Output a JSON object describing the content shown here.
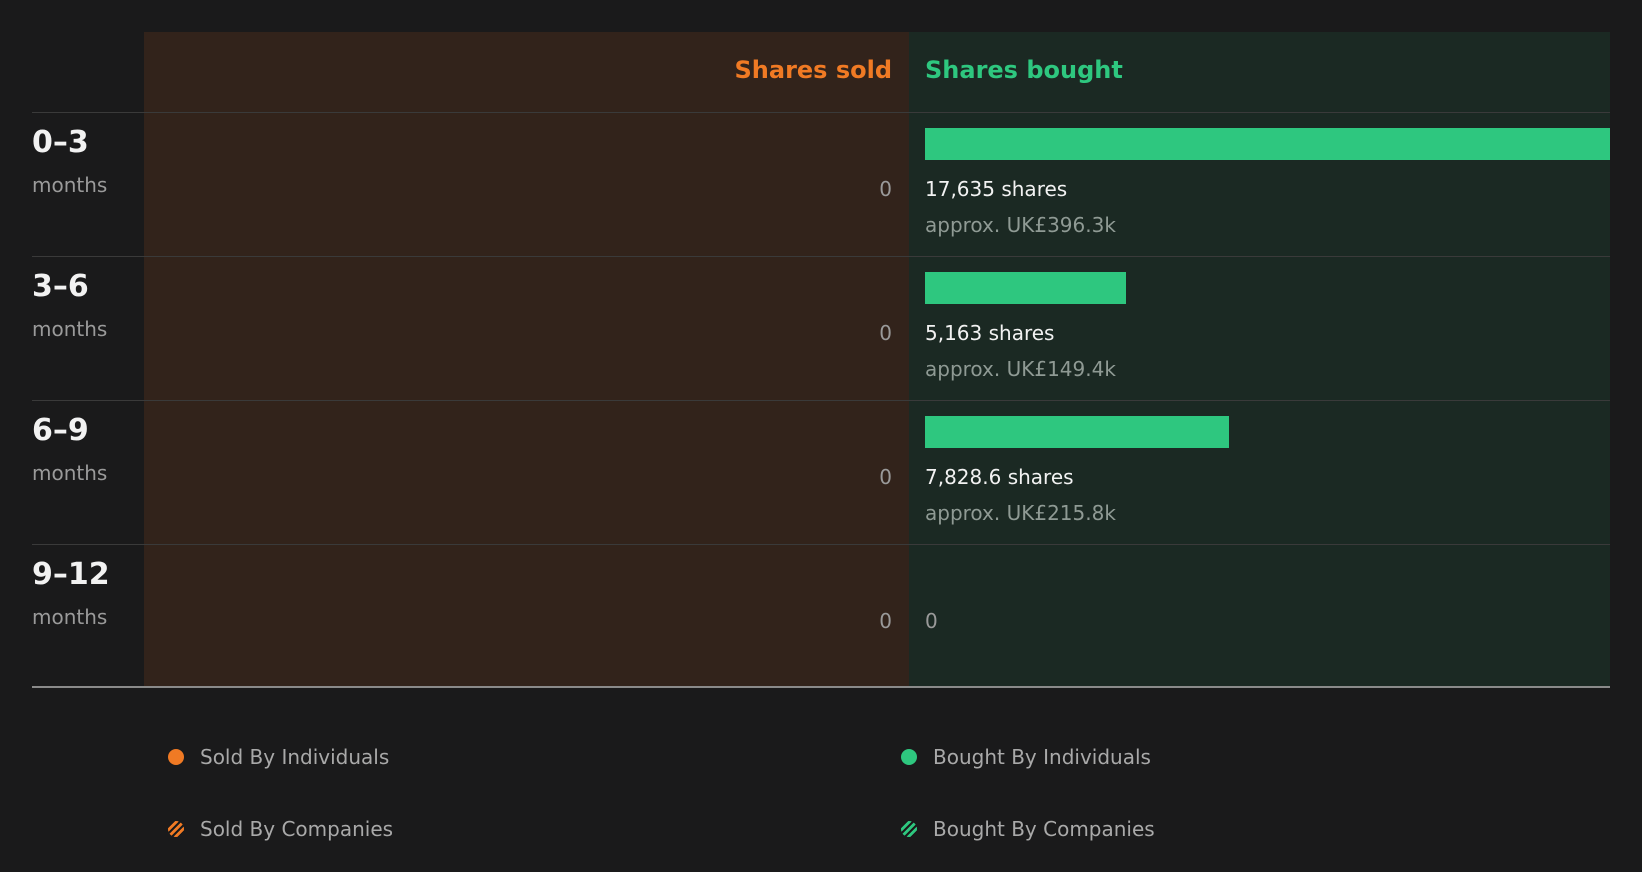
{
  "colors": {
    "sold": "#f07a24",
    "bought": "#2ec77f",
    "sold_bg": "#32231b",
    "bought_bg": "#1b2923",
    "background": "#1a1a1b"
  },
  "headers": {
    "sold": "Shares sold",
    "bought": "Shares bought"
  },
  "chart_data": {
    "type": "bar",
    "orientation": "horizontal-diverging",
    "categories": [
      "0–3 months",
      "3–6 months",
      "6–9 months",
      "9–12 months"
    ],
    "series": [
      {
        "name": "Shares sold",
        "values": [
          0,
          0,
          0,
          0
        ]
      },
      {
        "name": "Shares bought",
        "values": [
          17635,
          5163,
          7828.6,
          0
        ]
      }
    ],
    "xmax": 17635
  },
  "rows": [
    {
      "period": "0–3",
      "unit": "months",
      "sold": "0",
      "bought_value": 17635,
      "bought_shares": "17,635 shares",
      "bought_approx": "approx. UK£396.3k",
      "bought_zero": ""
    },
    {
      "period": "3–6",
      "unit": "months",
      "sold": "0",
      "bought_value": 5163,
      "bought_shares": "5,163 shares",
      "bought_approx": "approx. UK£149.4k",
      "bought_zero": ""
    },
    {
      "period": "6–9",
      "unit": "months",
      "sold": "0",
      "bought_value": 7828.6,
      "bought_shares": "7,828.6 shares",
      "bought_approx": "approx. UK£215.8k",
      "bought_zero": ""
    },
    {
      "period": "9–12",
      "unit": "months",
      "sold": "0",
      "bought_value": 0,
      "bought_shares": "",
      "bought_approx": "",
      "bought_zero": "0"
    }
  ],
  "legend": [
    {
      "label": "Sold By Individuals",
      "icon": "dot",
      "color": "#f07a24"
    },
    {
      "label": "Bought By Individuals",
      "icon": "dot",
      "color": "#2ec77f"
    },
    {
      "label": "Sold By Companies",
      "icon": "stripe",
      "color": "#f07a24"
    },
    {
      "label": "Bought By Companies",
      "icon": "stripe",
      "color": "#2ec77f"
    }
  ]
}
